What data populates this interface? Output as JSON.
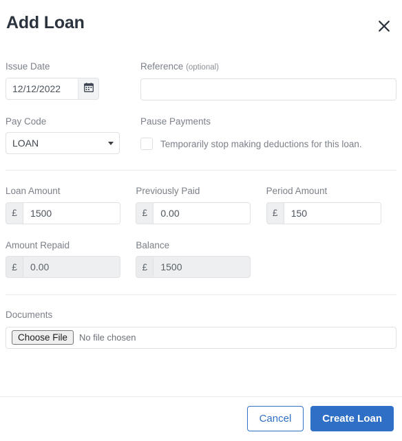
{
  "dialog": {
    "title": "Add Loan",
    "close_icon": "close-icon"
  },
  "fields": {
    "issue_date": {
      "label": "Issue Date",
      "value": "12/12/2022",
      "placeholder": "dd/mm/yyyy",
      "calendar_icon": "calendar-icon"
    },
    "reference": {
      "label": "Reference",
      "optional_note": "(optional)",
      "value": "",
      "placeholder": ""
    },
    "pay_code": {
      "label": "Pay Code",
      "value": "LOAN",
      "options": [
        "LOAN"
      ],
      "caret_icon": "chevron-down-icon"
    },
    "pause_payments": {
      "label": "Pause Payments",
      "checkbox_label": "Temporarily stop making deductions for this loan.",
      "checked": false
    },
    "loan_amount": {
      "label": "Loan Amount",
      "currency": "£",
      "value": "1500",
      "disabled": false
    },
    "previously_paid": {
      "label": "Previously Paid",
      "currency": "£",
      "value": "0.00",
      "disabled": false
    },
    "period_amount": {
      "label": "Period Amount",
      "currency": "£",
      "value": "150",
      "disabled": false
    },
    "amount_repaid": {
      "label": "Amount Repaid",
      "currency": "£",
      "value": "0.00",
      "disabled": true
    },
    "balance": {
      "label": "Balance",
      "currency": "£",
      "value": "1500",
      "disabled": true
    },
    "documents": {
      "label": "Documents",
      "choose_file_label": "Choose File",
      "no_file_text": "No file chosen"
    }
  },
  "footer": {
    "cancel_label": "Cancel",
    "submit_label": "Create Loan"
  },
  "colors": {
    "primary": "#2f6fc6",
    "label": "#7b8089",
    "title": "#2b333e",
    "border": "#dfe1e4",
    "divider": "#e9eaec",
    "addon_bg": "#eeeff0"
  }
}
